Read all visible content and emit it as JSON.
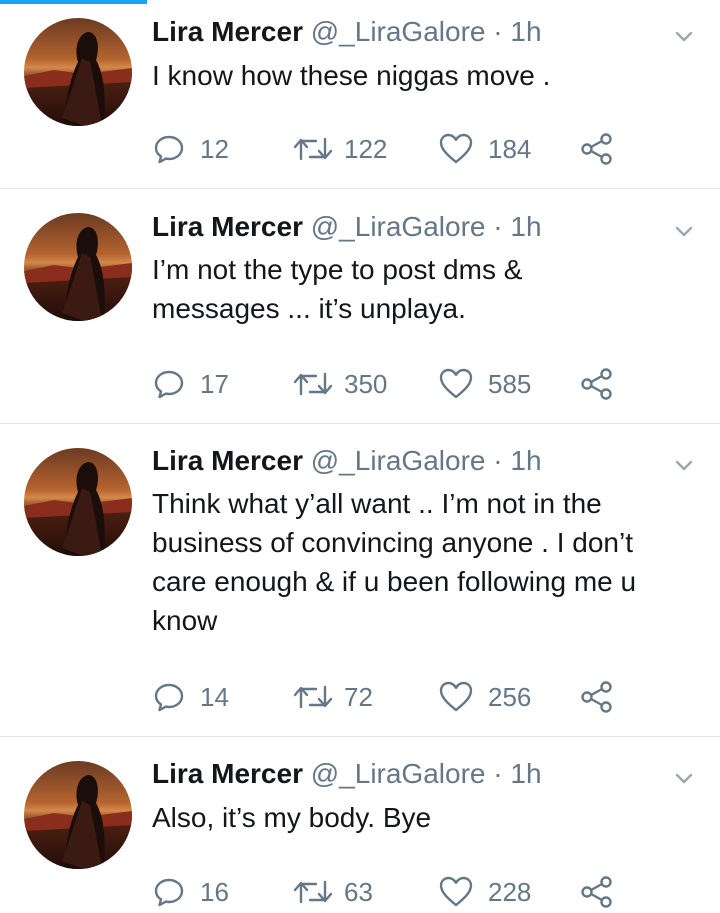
{
  "tweets": [
    {
      "name": "Lira Mercer",
      "handle": "@_LiraGalore",
      "dot": "·",
      "time": "1h",
      "text": "I know how these niggas move .",
      "replies": "12",
      "retweets": "122",
      "likes": "184"
    },
    {
      "name": "Lira Mercer",
      "handle": "@_LiraGalore",
      "dot": "·",
      "time": "1h",
      "text": "I’m not the type to post dms &\nmessages ... it’s unplaya.",
      "replies": "17",
      "retweets": "350",
      "likes": "585"
    },
    {
      "name": "Lira Mercer",
      "handle": "@_LiraGalore",
      "dot": "·",
      "time": "1h",
      "text": "Think what y’all want .. I’m not in the\nbusiness of convincing anyone . I don’t\ncare enough & if u been following me u\nknow",
      "replies": "14",
      "retweets": "72",
      "likes": "256"
    },
    {
      "name": "Lira Mercer",
      "handle": "@_LiraGalore",
      "dot": "·",
      "time": "1h",
      "text": "Also, it’s my body. Bye",
      "replies": "16",
      "retweets": "63",
      "likes": "228"
    }
  ],
  "icons": {
    "reply": "reply-icon",
    "retweet": "retweet-icon",
    "like": "heart-icon",
    "share": "share-icon",
    "menu": "chevron-down-icon"
  },
  "colors": {
    "accent": "#1da1f2",
    "name_text": "#14171a",
    "secondary_text": "#657786",
    "divider": "#e1e8ed"
  }
}
